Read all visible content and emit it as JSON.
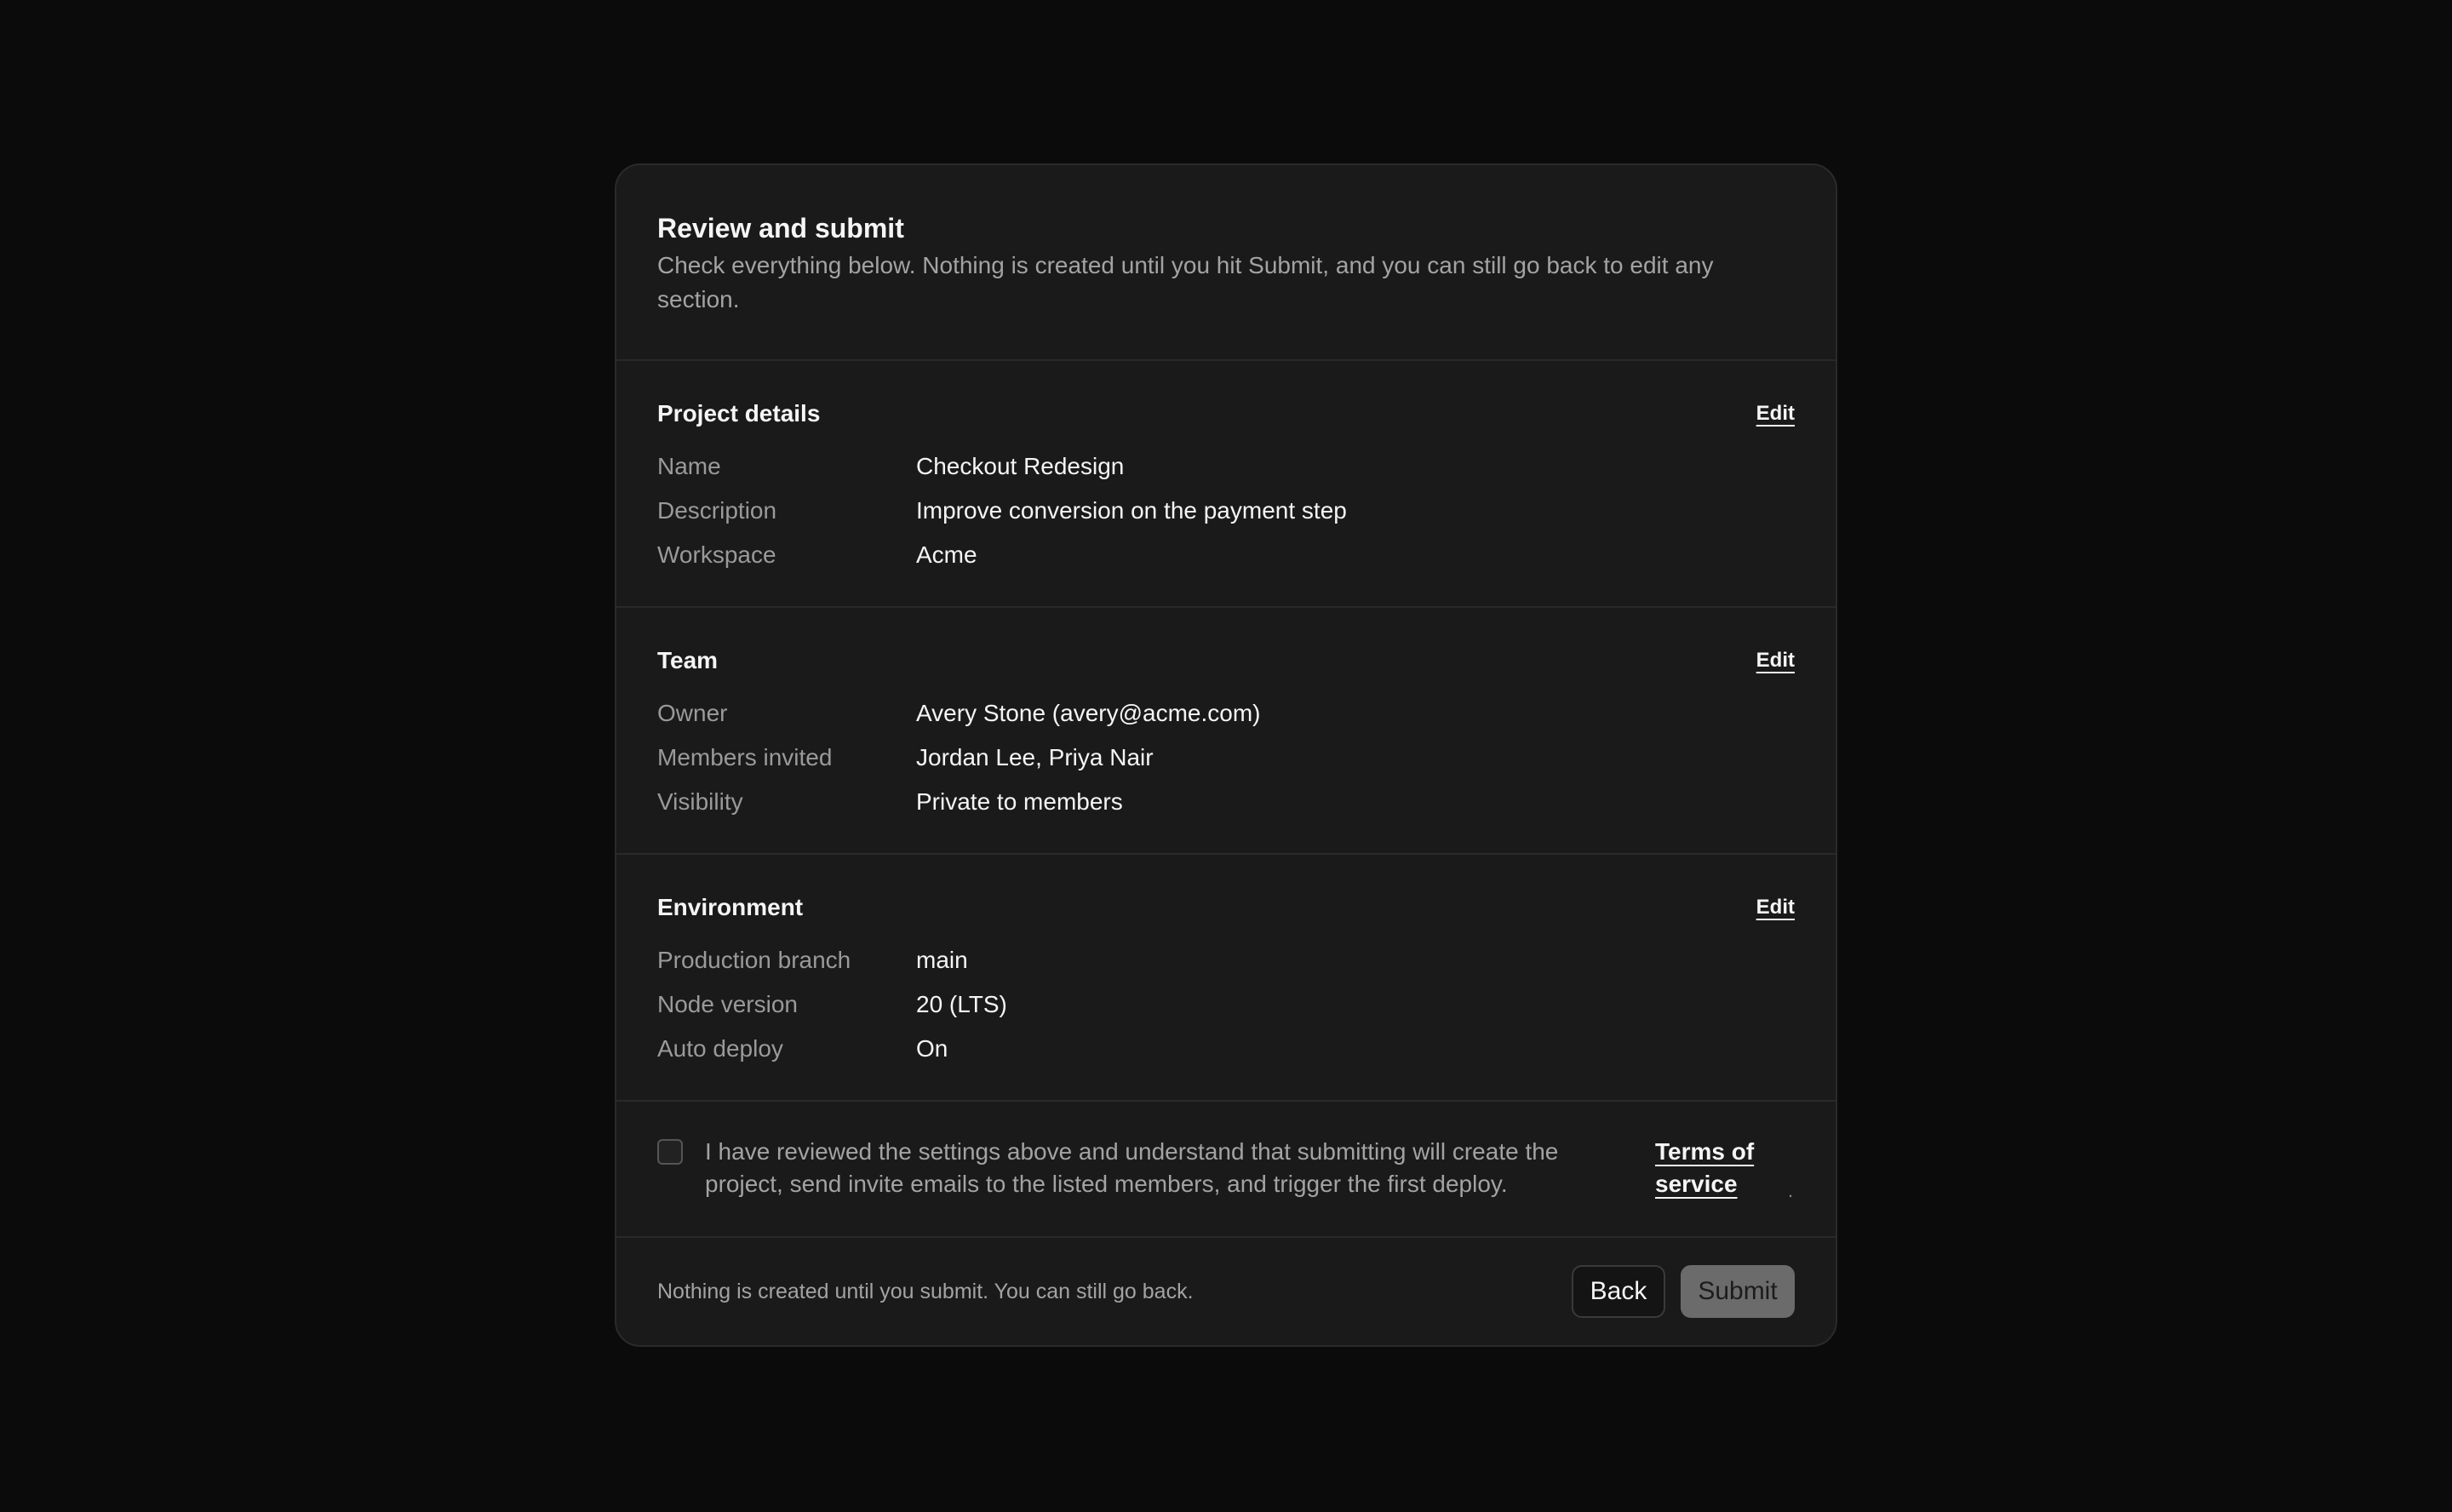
{
  "header": {
    "title": "Review and submit",
    "subtitle": "Check everything below. Nothing is created until you hit Submit, and you can still go back to edit any section."
  },
  "sections": [
    {
      "title": "Project details",
      "edit_label": "Edit",
      "rows": [
        {
          "label": "Name",
          "value": "Checkout Redesign"
        },
        {
          "label": "Description",
          "value": "Improve conversion on the payment step"
        },
        {
          "label": "Workspace",
          "value": "Acme"
        }
      ]
    },
    {
      "title": "Team",
      "edit_label": "Edit",
      "rows": [
        {
          "label": "Owner",
          "value": "Avery Stone (avery@acme.com)"
        },
        {
          "label": "Members invited",
          "value": "Jordan Lee, Priya Nair"
        },
        {
          "label": "Visibility",
          "value": "Private to members"
        }
      ]
    },
    {
      "title": "Environment",
      "edit_label": "Edit",
      "rows": [
        {
          "label": "Production branch",
          "value": "main"
        },
        {
          "label": "Node version",
          "value": "20 (LTS)"
        },
        {
          "label": "Auto deploy",
          "value": "On"
        }
      ]
    }
  ],
  "consent": {
    "checked": false,
    "text": "I have reviewed the settings above and understand that submitting will create the project, send invite emails to the listed members, and trigger the first deploy.",
    "terms_label": "Terms of service",
    "trailing": "."
  },
  "footer": {
    "note": "Nothing is created until you submit. You can still go back.",
    "back_label": "Back",
    "submit_label": "Submit"
  },
  "colors": {
    "background": "#0b0b0b",
    "card": "#1a1a1a",
    "border": "#2a2a2a",
    "muted_text": "#a3a3a3",
    "submit_disabled": "#6b6b6b"
  }
}
